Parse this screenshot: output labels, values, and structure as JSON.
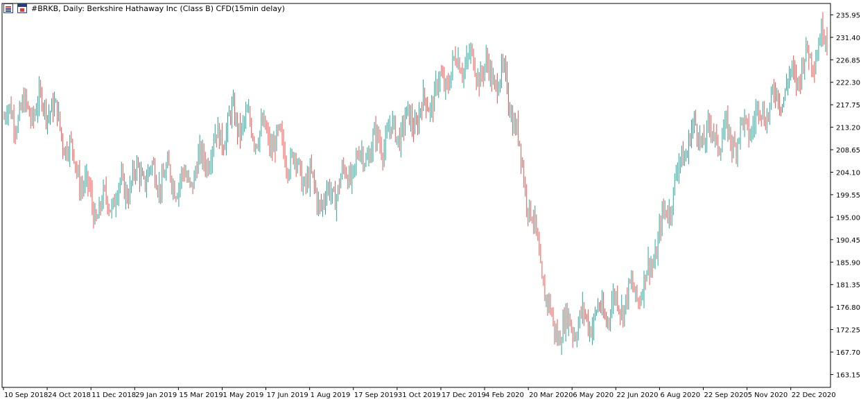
{
  "header": {
    "title": "#BRKB, Daily:  Berkshire Hathaway Inc (Class B) CFD(15min delay)",
    "icons": [
      "grid-icon",
      "window-icon"
    ]
  },
  "colors": {
    "bull": "#26a69a",
    "bear": "#ef5350",
    "axis": "#000000",
    "background": "#ffffff"
  },
  "chart_data": {
    "type": "ohlc-bar",
    "title": "#BRKB, Daily:  Berkshire Hathaway Inc (Class B) CFD(15min delay)",
    "ylim": [
      160.55,
      238.25
    ],
    "y_ticks": [
      "235.95",
      "231.40",
      "226.85",
      "222.30",
      "217.75",
      "213.20",
      "208.65",
      "204.10",
      "199.55",
      "195.00",
      "190.45",
      "185.90",
      "181.35",
      "176.80",
      "172.25",
      "167.70",
      "163.15"
    ],
    "x_ticks": [
      "10 Sep 2018",
      "24 Oct 2018",
      "11 Dec 2018",
      "29 Jan 2019",
      "15 Mar 2019",
      "1 May 2019",
      "17 Jun 2019",
      "1 Aug 2019",
      "17 Sep 2019",
      "31 Oct 2019",
      "17 Dec 2019",
      "4 Feb 2020",
      "20 Mar 2020",
      "6 May 2020",
      "22 Jun 2020",
      "6 Aug 2020",
      "22 Sep 2020",
      "5 Nov 2020",
      "22 Dec 2020"
    ],
    "close_path": [
      [
        "10 Sep 2018",
        215
      ],
      [
        "24 Oct 2018",
        218
      ],
      [
        "11 Dec 2018",
        196
      ],
      [
        "29 Jan 2019",
        204
      ],
      [
        "15 Mar 2019",
        202
      ],
      [
        "1 May 2019",
        215
      ],
      [
        "17 Jun 2019",
        210
      ],
      [
        "1 Aug 2019",
        198
      ],
      [
        "17 Sep 2019",
        209
      ],
      [
        "31 Oct 2019",
        215
      ],
      [
        "17 Dec 2019",
        227
      ],
      [
        "4 Feb 2020",
        222
      ],
      [
        "20 Mar 2020",
        172
      ],
      [
        "6 May 2020",
        175
      ],
      [
        "22 Jun 2020",
        181
      ],
      [
        "6 Aug 2020",
        212
      ],
      [
        "22 Sep 2020",
        211
      ],
      [
        "5 Nov 2020",
        220
      ],
      [
        "22 Dec 2020",
        232
      ]
    ],
    "range_high": 235.95,
    "range_low": 162.8
  }
}
